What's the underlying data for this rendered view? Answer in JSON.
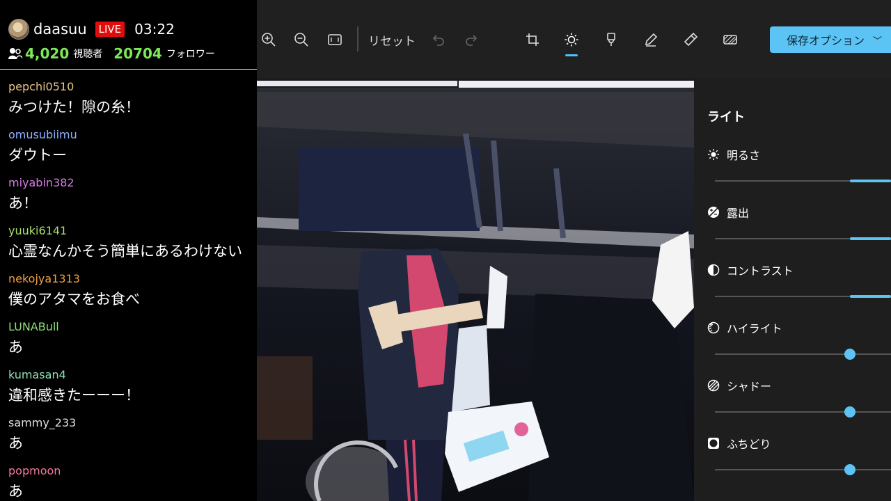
{
  "stream": {
    "streamer": "daasuu",
    "live_badge": "LIVE",
    "elapsed": "03:22",
    "viewers": "4,020",
    "viewers_label": "視聴者",
    "followers": "20704",
    "followers_label": "フォロワー"
  },
  "chat": [
    {
      "user": "pepchi0510",
      "text": "みつけた！隙の糸！",
      "color": "#e9c48a"
    },
    {
      "user": "omusubiimu",
      "text": "ダウトー",
      "color": "#8fb1ff"
    },
    {
      "user": "miyabin382",
      "text": "あ！",
      "color": "#d77be6"
    },
    {
      "user": "yuuki6141",
      "text": "心霊なんかそう簡単にあるわけない",
      "color": "#a8e070"
    },
    {
      "user": "nekojya1313",
      "text": "僕のアタマをお食べ",
      "color": "#f0a040"
    },
    {
      "user": "LUNABull",
      "text": "あ",
      "color": "#8ee07a"
    },
    {
      "user": "kumasan4",
      "text": "違和感きたーーー！",
      "color": "#8de0b8"
    },
    {
      "user": "sammy_233",
      "text": "あ",
      "color": "#e0e0e0"
    },
    {
      "user": "popmoon",
      "text": "あ",
      "color": "#f07a9a"
    }
  ],
  "toolbar": {
    "reset": "リセット",
    "save": "保存オプション",
    "icons": [
      "zoom-in-icon",
      "zoom-out-icon",
      "fit-screen-icon",
      "undo-icon",
      "redo-icon",
      "crop-icon",
      "brightness-icon",
      "filter-icon",
      "markup-icon",
      "spot-fix-icon",
      "background-blur-icon",
      "chevron-down-icon"
    ]
  },
  "adjust": {
    "section": "ライト",
    "items": [
      {
        "label": "明るさ",
        "icon": "sun-icon",
        "value": 1.0
      },
      {
        "label": "露出",
        "icon": "exposure-icon",
        "value": 1.0
      },
      {
        "label": "コントラスト",
        "icon": "contrast-icon",
        "value": 1.0
      },
      {
        "label": "ハイライト",
        "icon": "highlights-icon",
        "value": 0.77
      },
      {
        "label": "シャドー",
        "icon": "shadows-icon",
        "value": 0.77
      },
      {
        "label": "ふちどり",
        "icon": "vignette-icon",
        "value": 0.77
      }
    ]
  },
  "colors": {
    "accent": "#5cc4f5",
    "live": "#e00d0d",
    "count_green": "#7cea55"
  }
}
